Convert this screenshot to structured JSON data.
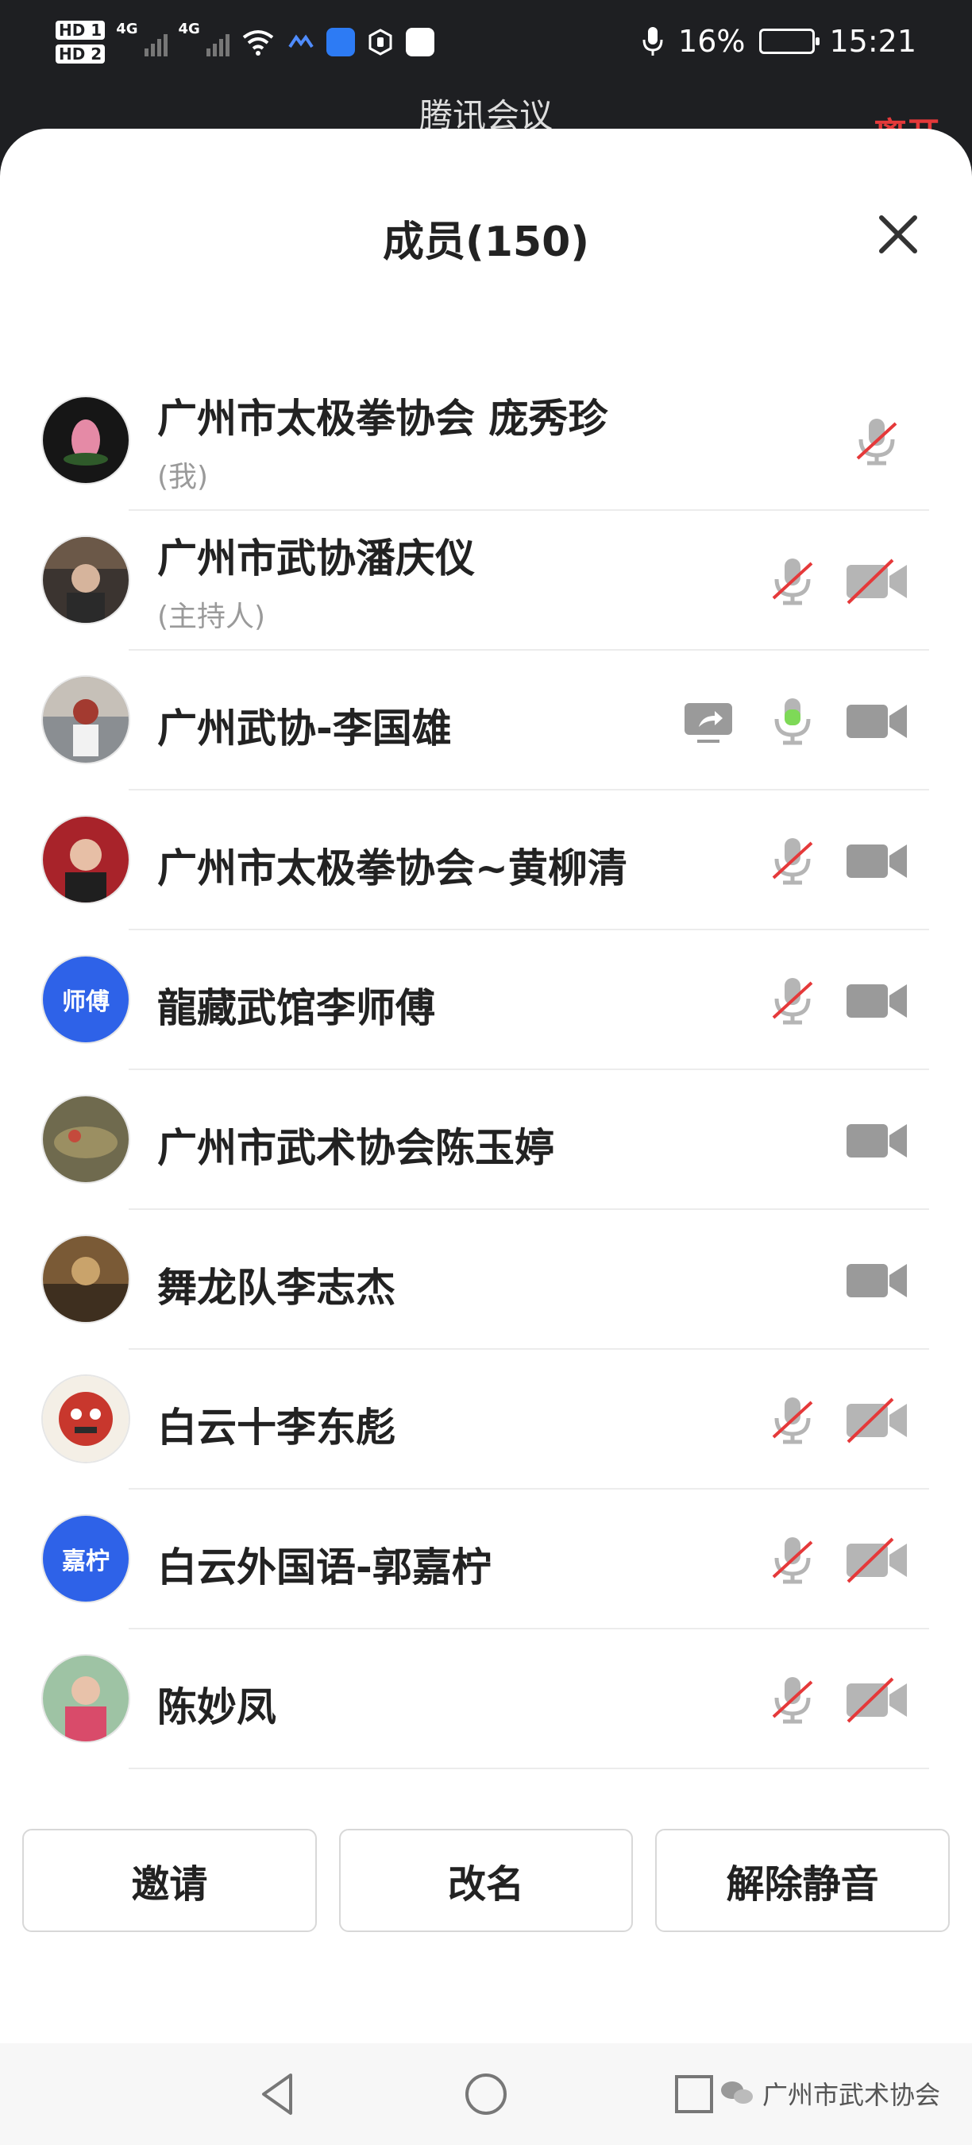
{
  "status_bar": {
    "hd1": "HD 1",
    "hd2": "HD 2",
    "net1": "4G",
    "net2": "4G",
    "battery_percent": "16%",
    "time": "15:21",
    "icons": [
      "signal-icon",
      "wifi-icon",
      "app-icon",
      "mic-indicator-icon",
      "battery-charging-icon"
    ]
  },
  "background_app": {
    "title": "腾讯会议",
    "leave": "离开"
  },
  "sheet": {
    "title": "成员(150)"
  },
  "members": [
    {
      "name": "广州市太极拳协会 庞秀珍",
      "role": "(我)",
      "mic": "muted"
    },
    {
      "name": "广州市武协潘庆仪",
      "role": "(主持人)",
      "mic": "muted",
      "video": "off"
    },
    {
      "name": "广州武协-李国雄",
      "role": "",
      "share": true,
      "mic": "active",
      "video": "on"
    },
    {
      "name": "广州市太极拳协会~黄柳清",
      "role": "",
      "mic": "muted",
      "video": "on"
    },
    {
      "name": "龍藏武馆李师傅",
      "role": "",
      "avatar_text": "师傅",
      "mic": "muted",
      "video": "on"
    },
    {
      "name": "广州市武术协会陈玉婷",
      "role": "",
      "video": "on"
    },
    {
      "name": "舞龙队李志杰",
      "role": "",
      "video": "on"
    },
    {
      "name": "白云十李东彪",
      "role": "",
      "mic": "muted",
      "video": "off"
    },
    {
      "name": "白云外国语-郭嘉柠",
      "role": "",
      "avatar_text": "嘉柠",
      "mic": "muted",
      "video": "off"
    },
    {
      "name": "陈妙凤",
      "role": "",
      "mic": "muted",
      "video": "off"
    }
  ],
  "buttons": {
    "invite": "邀请",
    "rename": "改名",
    "unmute": "解除静音"
  },
  "watermark": "广州市武术协会",
  "colors": {
    "accent_blue": "#2e62e8",
    "mute_red": "#e5393a",
    "active_green": "#7ed957",
    "icon_gray": "#9a9a9a"
  }
}
